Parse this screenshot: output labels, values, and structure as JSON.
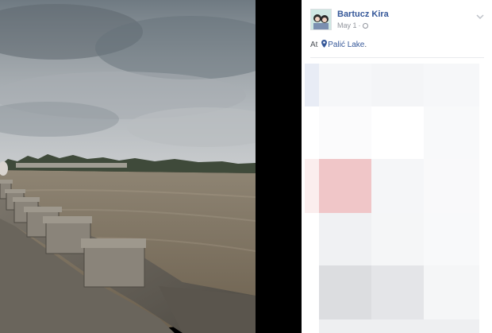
{
  "post": {
    "author": "Bartucz Kira",
    "date": "May 1",
    "location_prefix": "At",
    "location": "Palić Lake",
    "location_suffix": "."
  },
  "icons": [
    "globe-icon",
    "chevron-down-icon",
    "map-pin-icon"
  ],
  "colors": {
    "link": "#365899",
    "meta": "#90949c",
    "highlight_block": "#f0c6c8"
  }
}
